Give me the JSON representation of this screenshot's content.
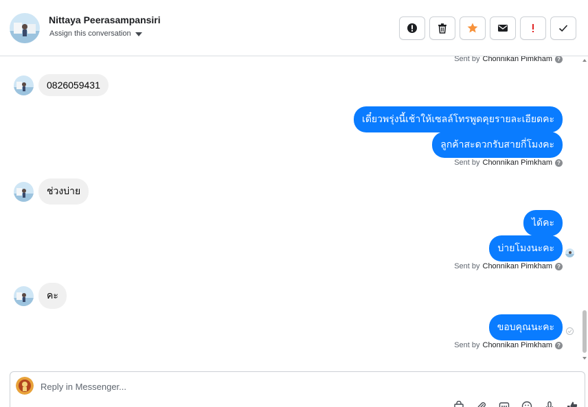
{
  "header": {
    "contact_name": "Nittaya Peerasampansiri",
    "assign_label": "Assign this conversation",
    "actions": [
      "warning-icon",
      "trash-icon",
      "star-icon",
      "envelope-icon",
      "exclamation-icon",
      "check-icon"
    ],
    "star_color": "#f7923b",
    "exclamation_color": "#e02020"
  },
  "messages": {
    "sent_prefix": "Sent by",
    "agent_name": "Chonnikan Pimkham",
    "help_glyph": "?",
    "in_1": "0826059431",
    "out_1": "เดี๋ยวพรุ่งนี้เช้าให้เซลล์โทรพูดคุยรายละเอียดคะ",
    "out_2": "ลูกค้าสะดวกรับสายกี่โมงคะ",
    "in_2": "ช่วงบ่าย",
    "out_3": "ได้คะ",
    "out_4": "บ่ายโมงนะคะ",
    "in_3": "คะ",
    "out_5": "ขอบคุณนะคะ",
    "outgoing_color": "#0a7cff",
    "incoming_color": "#f0f0f0"
  },
  "composer": {
    "placeholder": "Reply in Messenger...",
    "tools": [
      "bag-icon",
      "attachment-icon",
      "saved-replies-icon",
      "emoji-icon",
      "microphone-icon",
      "like-icon"
    ]
  }
}
